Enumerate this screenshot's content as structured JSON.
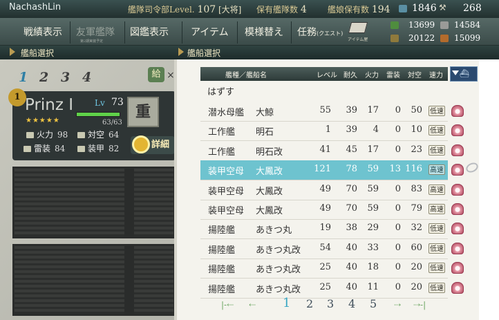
{
  "window": {
    "user": "NachashLin"
  },
  "hq": {
    "level_label": "艦隊司令部Level.",
    "level": "107",
    "rank": "[大将]",
    "ship_count_label": "保有艦隊数",
    "fleet_count": "4",
    "ship_slots_label": "艦娘保有数",
    "ship_count": "194",
    "bucket": "1846",
    "steel_top": "268"
  },
  "menu": {
    "items": [
      "戦績表示",
      "友軍艦隊",
      "図鑑表示",
      "アイテム",
      "模様替え",
      "任務"
    ],
    "quest_tag": "(クエスト)",
    "sub_label": "第2期実装予定",
    "item_shop_label": "アイテム屋"
  },
  "resources": {
    "fuel": "13699",
    "ammo": "20122",
    "steel": "14584",
    "bauxite": "15099",
    "colors": {
      "fuel": "#4f8d3e",
      "ammo": "#8f7a3c",
      "steel": "#9a9b98",
      "bauxite": "#b36b2c"
    }
  },
  "section": {
    "left_title": "艦船選択",
    "right_title": "艦船選択"
  },
  "fleet_tabs": [
    "1",
    "2",
    "3",
    "4"
  ],
  "supply_label": "給",
  "supply_x": "×",
  "ship_card": {
    "number": "1",
    "name": "Prinz I",
    "lv_label": "Lv",
    "level": "73",
    "hp": "63/63",
    "hp_ratio": 1.0,
    "stars": "★★★★★",
    "stats": [
      {
        "label": "火力",
        "value": "98"
      },
      {
        "label": "対空",
        "value": "64"
      },
      {
        "label": "雷装",
        "value": "84"
      },
      {
        "label": "装甲",
        "value": "82"
      }
    ],
    "class_badge": "重",
    "detail_label": "詳細"
  },
  "list": {
    "headers": [
      "艦種／艦船名",
      "レベル",
      "耐久",
      "火力",
      "雷装",
      "対空",
      "速力"
    ],
    "remove_label": "はずす",
    "rows": [
      {
        "type": "潜水母艦",
        "name": "大鯨",
        "level": "55",
        "hp": "39",
        "fire": "17",
        "torp": "0",
        "aa": "50",
        "speed": "低速"
      },
      {
        "type": "工作艦",
        "name": "明石",
        "level": "1",
        "hp": "39",
        "fire": "4",
        "torp": "0",
        "aa": "10",
        "speed": "低速"
      },
      {
        "type": "工作艦",
        "name": "明石改",
        "level": "41",
        "hp": "45",
        "fire": "17",
        "torp": "0",
        "aa": "23",
        "speed": "低速"
      },
      {
        "type": "装甲空母",
        "name": "大鳳改",
        "level": "121",
        "hp": "78",
        "fire": "59",
        "torp": "13",
        "aa": "116",
        "speed": "高速",
        "selected": true
      },
      {
        "type": "装甲空母",
        "name": "大鳳改",
        "level": "49",
        "hp": "70",
        "fire": "59",
        "torp": "0",
        "aa": "83",
        "speed": "高速"
      },
      {
        "type": "装甲空母",
        "name": "大鳳改",
        "level": "49",
        "hp": "70",
        "fire": "59",
        "torp": "0",
        "aa": "79",
        "speed": "高速"
      },
      {
        "type": "揚陸艦",
        "name": "あきつ丸",
        "level": "19",
        "hp": "38",
        "fire": "29",
        "torp": "0",
        "aa": "32",
        "speed": "低速"
      },
      {
        "type": "揚陸艦",
        "name": "あきつ丸改",
        "level": "54",
        "hp": "40",
        "fire": "33",
        "torp": "0",
        "aa": "60",
        "speed": "低速"
      },
      {
        "type": "揚陸艦",
        "name": "あきつ丸改",
        "level": "25",
        "hp": "40",
        "fire": "18",
        "torp": "0",
        "aa": "20",
        "speed": "低速"
      },
      {
        "type": "揚陸艦",
        "name": "あきつ丸改",
        "level": "25",
        "hp": "40",
        "fire": "11",
        "torp": "0",
        "aa": "20",
        "speed": "低速"
      }
    ]
  },
  "pager": {
    "first": "|-⇠",
    "prev": "⇠",
    "pages": [
      "1",
      "2",
      "3",
      "4",
      "5"
    ],
    "current": "1",
    "next": "⇢",
    "last": "⇢-|"
  },
  "accent": {
    "selected_row": "#6ec3cf",
    "active_tab": "#2f7fa5"
  }
}
